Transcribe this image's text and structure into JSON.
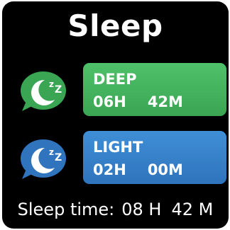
{
  "screen": {
    "title": "Sleep"
  },
  "deep": {
    "label": "DEEP",
    "hours": "06H",
    "minutes": "42M",
    "icon": "moon-zz-icon",
    "color": "#3aa553"
  },
  "light": {
    "label": "LIGHT",
    "hours": "02H",
    "minutes": "00M",
    "icon": "moon-zz-icon",
    "color": "#2f74bd"
  },
  "summary": {
    "label": "Sleep time:",
    "hours": "08 H",
    "minutes": "42 M"
  }
}
